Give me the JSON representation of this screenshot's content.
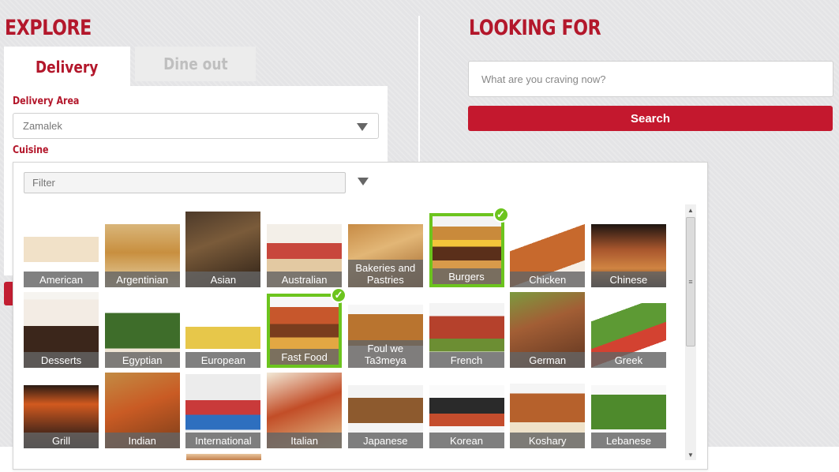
{
  "explore": {
    "title": "EXPLORE",
    "tabs": [
      {
        "label": "Delivery",
        "active": true
      },
      {
        "label": "Dine out",
        "active": false
      }
    ],
    "delivery_area_label": "Delivery Area",
    "delivery_area_value": "Zamalek",
    "cuisine_label": "Cuisine"
  },
  "looking_for": {
    "title": "LOOKING FOR",
    "search_placeholder": "What are you craving now?",
    "search_button": "Search"
  },
  "cuisine_dropdown": {
    "filter_placeholder": "Filter",
    "items": [
      {
        "label": "American",
        "selected": false
      },
      {
        "label": "Argentinian",
        "selected": false
      },
      {
        "label": "Asian",
        "selected": false
      },
      {
        "label": "Australian",
        "selected": false
      },
      {
        "label": "Bakeries and Pastries",
        "selected": false
      },
      {
        "label": "Burgers",
        "selected": true
      },
      {
        "label": "Chicken",
        "selected": false
      },
      {
        "label": "Chinese",
        "selected": false
      },
      {
        "label": "Desserts",
        "selected": false
      },
      {
        "label": "Egyptian",
        "selected": false
      },
      {
        "label": "European",
        "selected": false
      },
      {
        "label": "Fast Food",
        "selected": true
      },
      {
        "label": "Foul we Ta3meya",
        "selected": false
      },
      {
        "label": "French",
        "selected": false
      },
      {
        "label": "German",
        "selected": false
      },
      {
        "label": "Greek",
        "selected": false
      },
      {
        "label": "Grill",
        "selected": false
      },
      {
        "label": "Indian",
        "selected": false
      },
      {
        "label": "International",
        "selected": false
      },
      {
        "label": "Italian",
        "selected": false
      },
      {
        "label": "Japanese",
        "selected": false
      },
      {
        "label": "Korean",
        "selected": false
      },
      {
        "label": "Koshary",
        "selected": false
      },
      {
        "label": "Lebanese",
        "selected": false
      }
    ]
  },
  "colors": {
    "brand_red": "#b3172b",
    "button_red": "#c4182e",
    "selected_green": "#6cc41e"
  },
  "icons": {
    "dropdown": "caret-down-icon",
    "check": "check-icon"
  }
}
